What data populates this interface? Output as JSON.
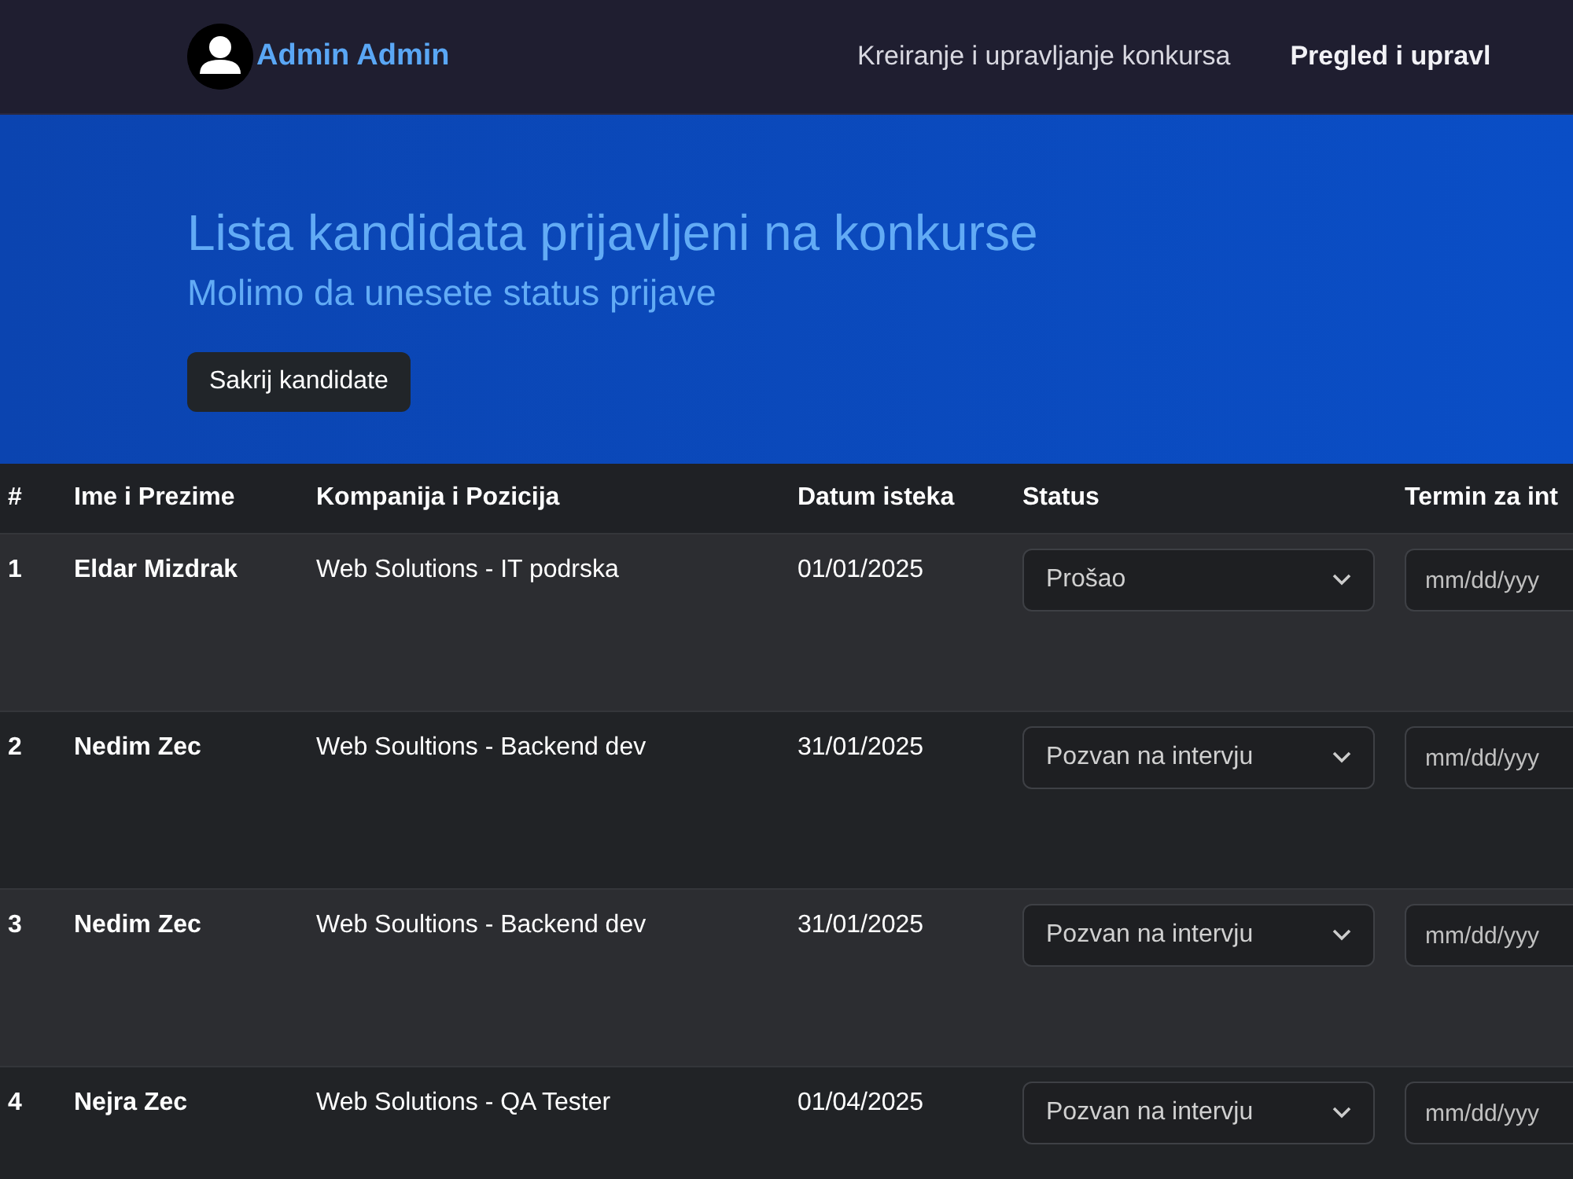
{
  "navbar": {
    "user": "Admin Admin",
    "links": [
      {
        "label": "Kreiranje i upravljanje konkursa",
        "selected": false
      },
      {
        "label": "Pregled i upravl",
        "selected": true
      }
    ]
  },
  "hero": {
    "title": "Lista kandidata prijavljeni na konkurse",
    "subtitle": "Molimo da unesete status prijave",
    "button": "Sakrij kandidate"
  },
  "table": {
    "columns": [
      "#",
      "Ime i Prezime",
      "Kompanija i Pozicija",
      "Datum isteka",
      "Status",
      "Termin za int"
    ],
    "rows": [
      {
        "index": "1",
        "name": "Eldar Mizdrak",
        "company": "Web Solutions - IT podrska",
        "date": "01/01/2025",
        "status": "Prošao",
        "termin_placeholder": "mm/dd/yyy"
      },
      {
        "index": "2",
        "name": "Nedim Zec",
        "company": "Web Soultions - Backend dev",
        "date": "31/01/2025",
        "status": "Pozvan na intervju",
        "termin_placeholder": "mm/dd/yyy"
      },
      {
        "index": "3",
        "name": "Nedim Zec",
        "company": "Web Soultions - Backend dev",
        "date": "31/01/2025",
        "status": "Pozvan na intervju",
        "termin_placeholder": "mm/dd/yyy"
      },
      {
        "index": "4",
        "name": "Nejra Zec",
        "company": "Web Solutions - QA Tester",
        "date": "01/04/2025",
        "status": "Pozvan na intervju",
        "termin_placeholder": "mm/dd/yyy"
      }
    ]
  }
}
